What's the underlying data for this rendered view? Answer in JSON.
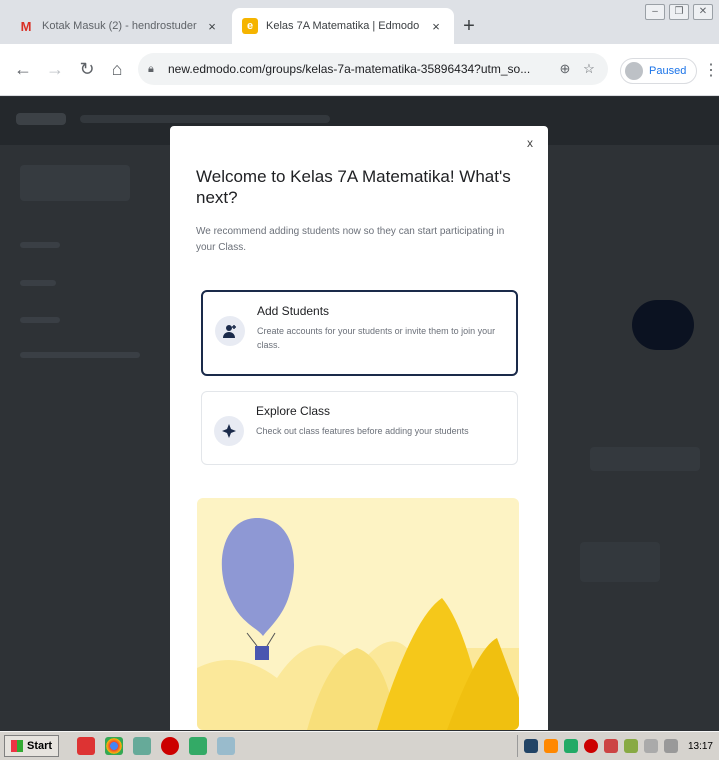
{
  "browser": {
    "tabs": [
      {
        "title": "Kotak Masuk (2) - hendrostuder",
        "favicon": "gmail-icon",
        "active": false
      },
      {
        "title": "Kelas 7A Matematika | Edmodo",
        "favicon": "edmodo-icon",
        "active": true
      }
    ],
    "new_tab": "+",
    "url": "new.edmodo.com/groups/kelas-7a-matematika-35896434?utm_so...",
    "profile_label": "Paused"
  },
  "modal": {
    "close_label": "x",
    "title": "Welcome to Kelas 7A Matematika! What's next?",
    "intro": "We recommend adding students now so they can start participating in your Class.",
    "options": [
      {
        "title": "Add Students",
        "description": "Create accounts for your students or invite them to join your class.",
        "icon": "add-user-icon"
      },
      {
        "title": "Explore Class",
        "description": "Check out class features before adding your students",
        "icon": "sparkle-icon"
      }
    ]
  },
  "taskbar": {
    "start_label": "Start",
    "clock": "13:17"
  },
  "colors": {
    "accent": "#1a2a4a",
    "illustration_bg": "#fdf3c4",
    "balloon": "#8e98d4",
    "mountain": "#f5c81a"
  }
}
